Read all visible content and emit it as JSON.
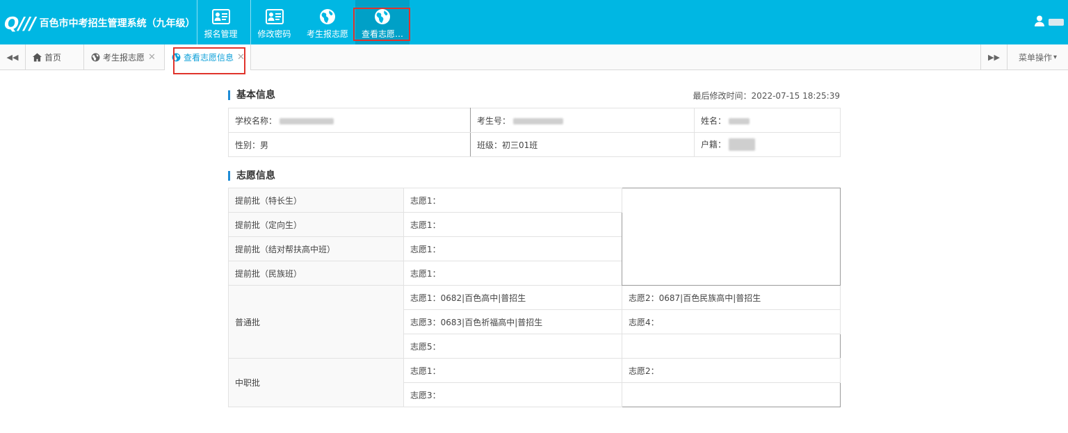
{
  "app": {
    "logo_text": "Q///",
    "title": "百色市中考招生管理系统（九年级）"
  },
  "topnav": [
    {
      "label": "报名管理",
      "icon": "id-card-icon"
    },
    {
      "label": "修改密码",
      "icon": "id-card-icon"
    },
    {
      "label": "考生报志愿",
      "icon": "globe-icon"
    },
    {
      "label": "查看志愿…",
      "icon": "globe-icon"
    }
  ],
  "user": {
    "icon": "user-icon"
  },
  "tabs": {
    "home": "首页",
    "items": [
      {
        "label": "考生报志愿",
        "icon": "globe-icon"
      },
      {
        "label": "查看志愿信息",
        "icon": "globe-icon"
      }
    ],
    "menu_label": "菜单操作",
    "menu_arrow": "▾",
    "prev_glyph": "◀◀",
    "next_glyph": "▶▶",
    "close_glyph": "✕"
  },
  "basic_info": {
    "title": "基本信息",
    "last_modified_label": "最后修改时间：",
    "last_modified_value": "2022-07-15 18:25:39",
    "school_label": "学校名称：",
    "exam_no_label": "考生号：",
    "name_label": "姓名：",
    "gender_label": "性别：",
    "gender_value": "男",
    "class_label": "班级：",
    "class_value": "初三01班",
    "hukou_label": "户籍："
  },
  "wish_info": {
    "title": "志愿信息",
    "early": [
      {
        "batch": "提前批（特长生）",
        "wish": "志愿1："
      },
      {
        "batch": "提前批（定向生）",
        "wish": "志愿1："
      },
      {
        "batch": "提前批（结对帮扶高中班）",
        "wish": "志愿1："
      },
      {
        "batch": "提前批（民族班）",
        "wish": "志愿1："
      }
    ],
    "general": {
      "batch": "普通批",
      "wish1": "志愿1：0682|百色高中|普招生",
      "wish2": "志愿2：0687|百色民族高中|普招生",
      "wish3": "志愿3：0683|百色祈福高中|普招生",
      "wish4": "志愿4：",
      "wish5": "志愿5："
    },
    "vocational": {
      "batch": "中职批",
      "wish1": "志愿1：",
      "wish2": "志愿2：",
      "wish3": "志愿3："
    }
  },
  "colors": {
    "header_bg": "#00b7e3",
    "accent": "#1e8cd6",
    "active_tab_text": "#10a1d9",
    "highlight": "#e0332b"
  }
}
